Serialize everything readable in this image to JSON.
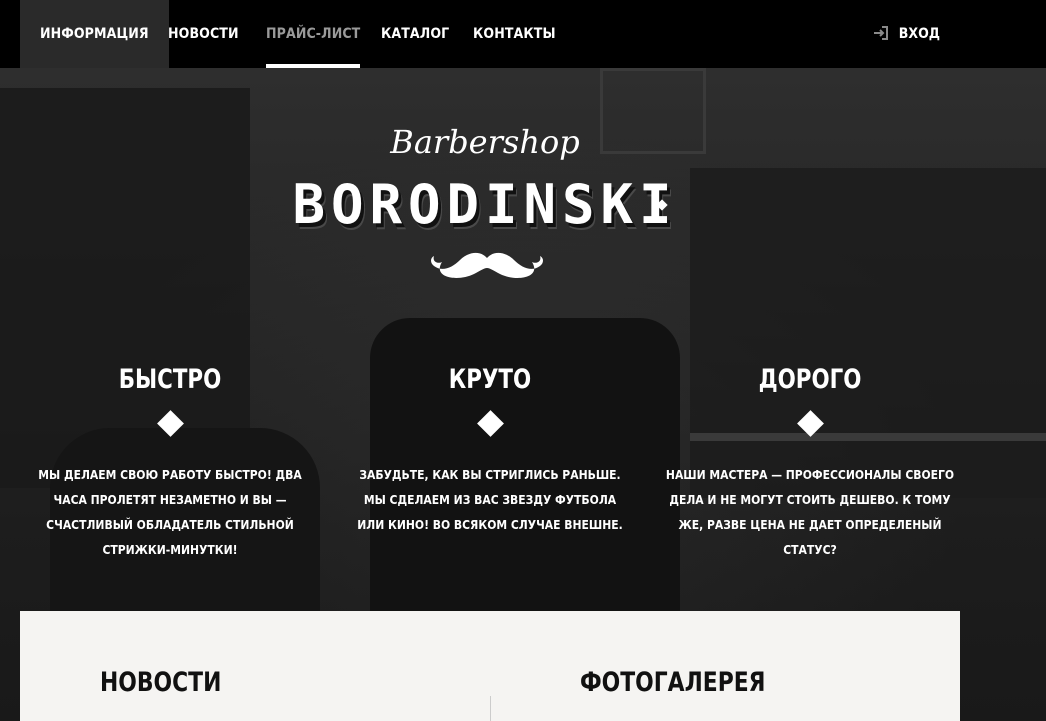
{
  "nav": {
    "items": [
      {
        "label": "ИНФОРМАЦИЯ"
      },
      {
        "label": "НОВОСТИ"
      },
      {
        "label": "ПРАЙС-ЛИСТ"
      },
      {
        "label": "КАТАЛОГ"
      },
      {
        "label": "КОНТАКТЫ"
      }
    ],
    "login_label": "ВХОД"
  },
  "logo": {
    "script": "Barbershop",
    "main": "BORODINSKI"
  },
  "features": [
    {
      "title": "БЫСТРО",
      "text": "МЫ ДЕЛАЕМ СВОЮ РАБОТУ БЫСТРО! ДВА ЧАСА ПРОЛЕТЯТ НЕЗАМЕТНО И ВЫ — СЧАСТЛИВЫЙ ОБЛАДАТЕЛЬ СТИЛЬНОЙ СТРИЖКИ-МИНУТКИ!"
    },
    {
      "title": "КРУТО",
      "text": "ЗАБУДЬТЕ, КАК ВЫ СТРИГЛИСЬ РАНЬШЕ. МЫ СДЕЛАЕМ ИЗ ВАС ЗВЕЗДУ ФУТБОЛА ИЛИ КИНО! ВО ВСЯКОМ СЛУЧАЕ ВНЕШНЕ."
    },
    {
      "title": "ДОРОГО",
      "text": "НАШИ МАСТЕРА — ПРОФЕССИОНАЛЫ СВОЕГО ДЕЛА И НЕ МОГУТ СТОИТЬ ДЕШЕВО. К ТОМУ ЖЕ, РАЗВЕ ЦЕНА НЕ ДАЕТ ОПРЕДЕЛЕНЫЙ СТАТУС?"
    }
  ],
  "sections": {
    "news_title": "НОВОСТИ",
    "gallery_title": "ФОТОГАЛЕРЕЯ"
  },
  "colors": {
    "nav_bg": "#000000",
    "nav_active_bg": "#2a2a2a",
    "panel_bg": "#f5f4f2",
    "text_light": "#ffffff"
  }
}
